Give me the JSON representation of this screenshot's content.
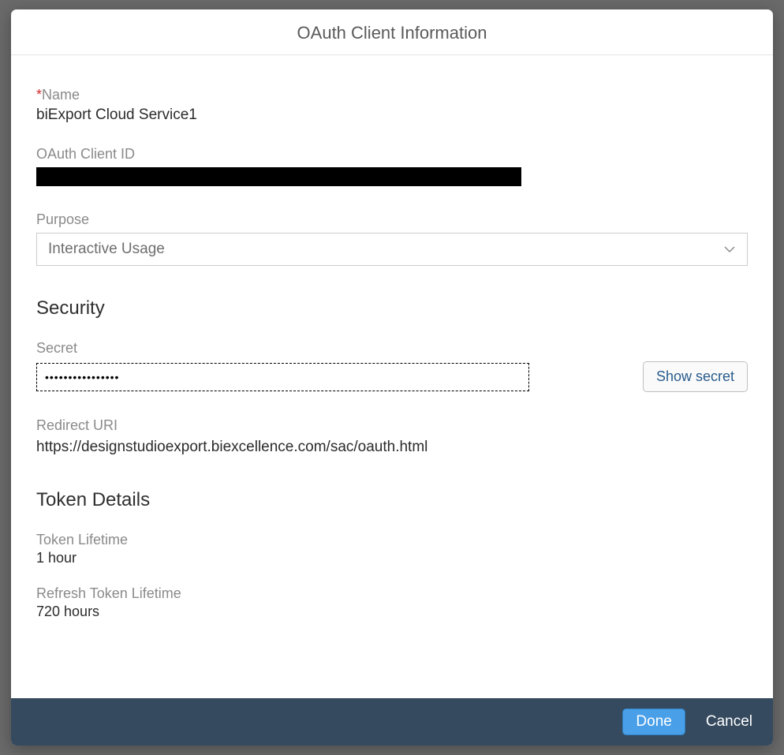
{
  "dialog": {
    "title": "OAuth Client Information",
    "name": {
      "label": "Name",
      "required_marker": "*",
      "value": "biExport Cloud Service1"
    },
    "clientId": {
      "label": "OAuth Client ID"
    },
    "purpose": {
      "label": "Purpose",
      "selected": "Interactive Usage"
    },
    "security": {
      "heading": "Security",
      "secret_label": "Secret",
      "secret_mask": "••••••••••••••••",
      "show_secret_label": "Show secret",
      "redirect_label": "Redirect URI",
      "redirect_value": "https://designstudioexport.biexcellence.com/sac/oauth.html"
    },
    "token": {
      "heading": "Token Details",
      "lifetime_label": "Token Lifetime",
      "lifetime_value": "1 hour",
      "refresh_label": "Refresh Token Lifetime",
      "refresh_value": "720 hours"
    },
    "footer": {
      "done": "Done",
      "cancel": "Cancel"
    }
  }
}
